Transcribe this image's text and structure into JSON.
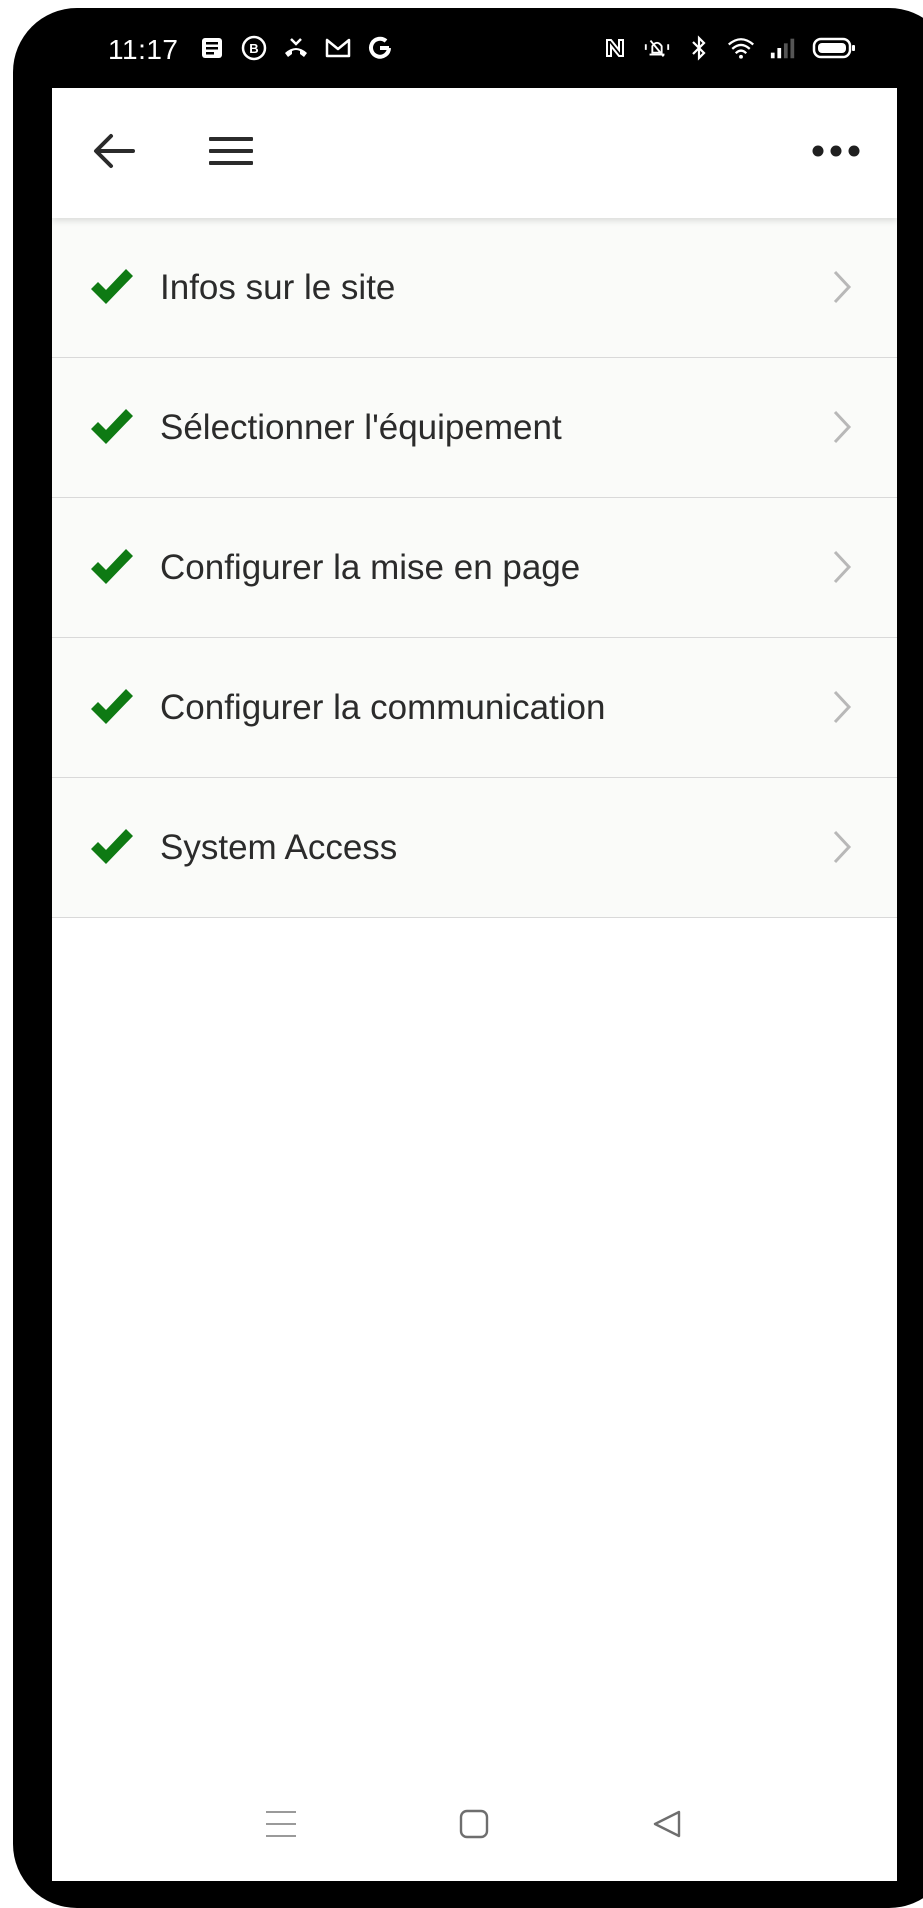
{
  "status_bar": {
    "time": "11:17",
    "left_icons": [
      "news-icon",
      "b-circle-icon",
      "missed-call-icon",
      "gmail-icon",
      "google-icon"
    ],
    "right_icons": [
      "nfc-icon",
      "vibrate-icon",
      "bluetooth-icon",
      "wifi-icon",
      "signal-icon",
      "battery-icon"
    ]
  },
  "app_bar": {
    "back_icon": "arrow-left-icon",
    "menu_icon": "hamburger-menu-icon",
    "more_icon": "more-horizontal-icon"
  },
  "list": {
    "items": [
      {
        "label": "Infos sur le site",
        "status": "complete"
      },
      {
        "label": "Sélectionner l'équipement",
        "status": "complete"
      },
      {
        "label": "Configurer la mise en page",
        "status": "complete"
      },
      {
        "label": "Configurer la communication",
        "status": "complete"
      },
      {
        "label": "System Access",
        "status": "complete"
      }
    ]
  },
  "nav_bar": {
    "buttons": [
      "recents-icon",
      "home-icon",
      "back-triangle-icon"
    ]
  },
  "colors": {
    "check": "#0e7a13",
    "chevron": "#b8b8b8",
    "text": "#2b2b2b",
    "list_bg": "#fafbf9",
    "divider": "#d9d9d9"
  }
}
